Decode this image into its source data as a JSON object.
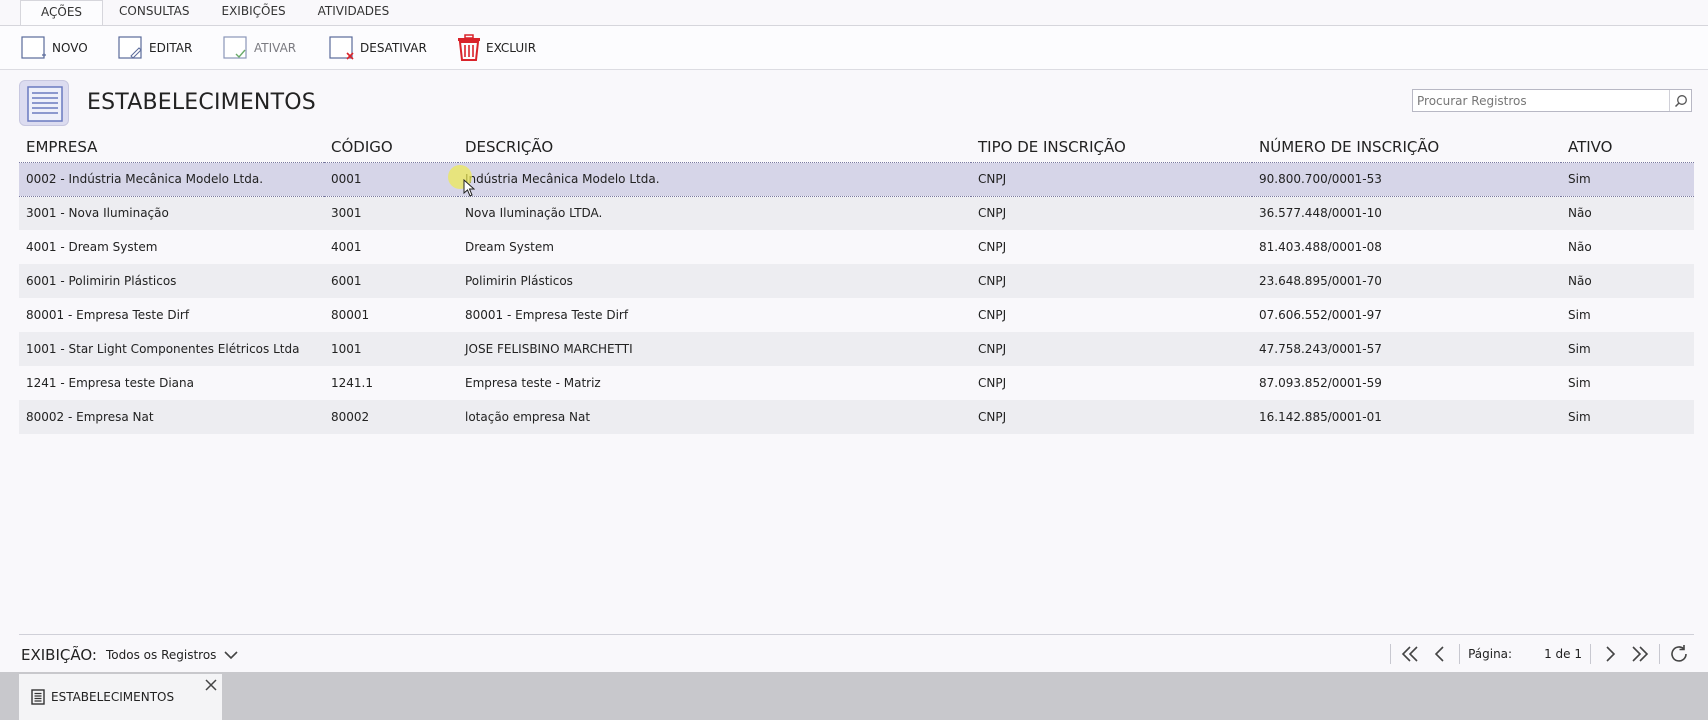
{
  "ribbon": {
    "tabs": [
      {
        "label": "AÇÕES",
        "active": true
      },
      {
        "label": "CONSULTAS",
        "active": false
      },
      {
        "label": "EXIBIÇÕES",
        "active": false
      },
      {
        "label": "ATIVIDADES",
        "active": false
      }
    ],
    "actions": {
      "novo": "NOVO",
      "editar": "EDITAR",
      "ativar": "ATIVAR",
      "desativar": "DESATIVAR",
      "excluir": "EXCLUIR"
    }
  },
  "page": {
    "title": "ESTABELECIMENTOS",
    "icon": "list-document-icon"
  },
  "search": {
    "placeholder": "Procurar Registros",
    "value": ""
  },
  "table": {
    "columns": [
      "EMPRESA",
      "CÓDIGO",
      "DESCRIÇÃO",
      "TIPO DE INSCRIÇÃO",
      "NÚMERO DE INSCRIÇÃO",
      "ATIVO"
    ],
    "selected_row": 0,
    "rows": [
      [
        "0002 - Indústria Mecânica Modelo Ltda.",
        "0001",
        "Indústria Mecânica Modelo Ltda.",
        "CNPJ",
        "90.800.700/0001-53",
        "Sim"
      ],
      [
        "3001 - Nova Iluminação",
        "3001",
        "Nova Iluminação LTDA.",
        "CNPJ",
        "36.577.448/0001-10",
        "Não"
      ],
      [
        "4001 - Dream System",
        "4001",
        "Dream System",
        "CNPJ",
        "81.403.488/0001-08",
        "Não"
      ],
      [
        "6001 - Polimirin Plásticos",
        "6001",
        "Polimirin Plásticos",
        "CNPJ",
        "23.648.895/0001-70",
        "Não"
      ],
      [
        "80001 - Empresa Teste Dirf",
        "80001",
        "80001 - Empresa Teste Dirf",
        "CNPJ",
        "07.606.552/0001-97",
        "Sim"
      ],
      [
        "1001 - Star Light Componentes Elétricos Ltda",
        "1001",
        "JOSE FELISBINO MARCHETTI",
        "CNPJ",
        "47.758.243/0001-57",
        "Sim"
      ],
      [
        "1241 - Empresa teste Diana",
        "1241.1",
        "Empresa teste - Matriz",
        "CNPJ",
        "87.093.852/0001-59",
        "Sim"
      ],
      [
        "80002 - Empresa Nat",
        "80002",
        "lotação empresa Nat",
        "CNPJ",
        "16.142.885/0001-01",
        "Sim"
      ]
    ]
  },
  "footer": {
    "exibicao_label": "EXIBIÇÃO:",
    "exibicao_value": "Todos os Registros",
    "pagina_label": "Página:",
    "pagina_value": "1 de 1"
  },
  "bottom_tab": {
    "label": "ESTABELECIMENTOS"
  },
  "colors": {
    "selected_row": "#d6d5e8",
    "alt_row": "#ededf1",
    "delete_red": "#d9232a",
    "page_icon_bg": "#dcdcf0"
  }
}
